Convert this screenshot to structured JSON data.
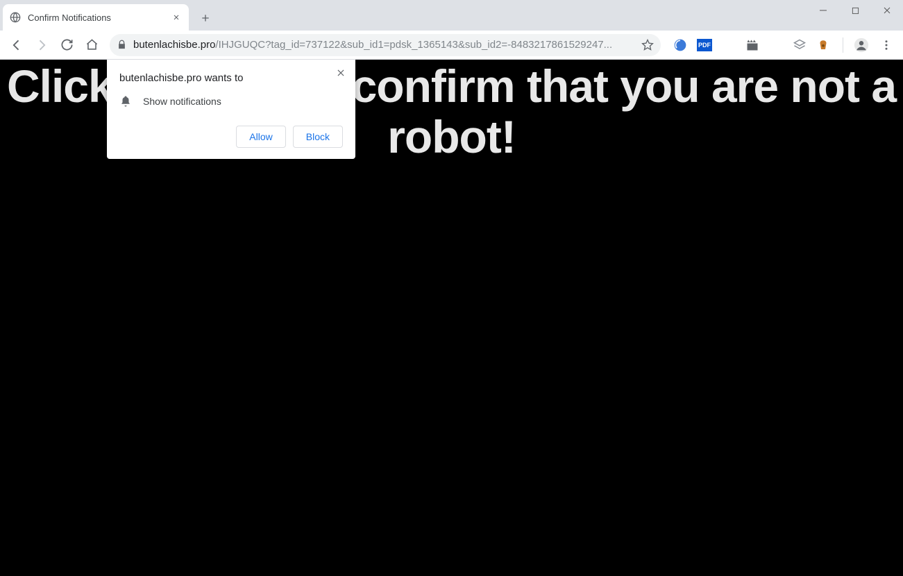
{
  "window": {
    "tab_title": "Confirm Notifications"
  },
  "toolbar": {
    "url_host": "butenlachisbe.pro",
    "url_path": "/IHJGUQC?tag_id=737122&sub_id1=pdsk_1365143&sub_id2=-8483217861529247..."
  },
  "page": {
    "heading": "Click \"Allow\" to confirm that you are not a robot!"
  },
  "popup": {
    "title": "butenlachisbe.pro wants to",
    "permission_text": "Show notifications",
    "allow_label": "Allow",
    "block_label": "Block"
  },
  "extensions": {
    "pdf_label": "PDF"
  }
}
